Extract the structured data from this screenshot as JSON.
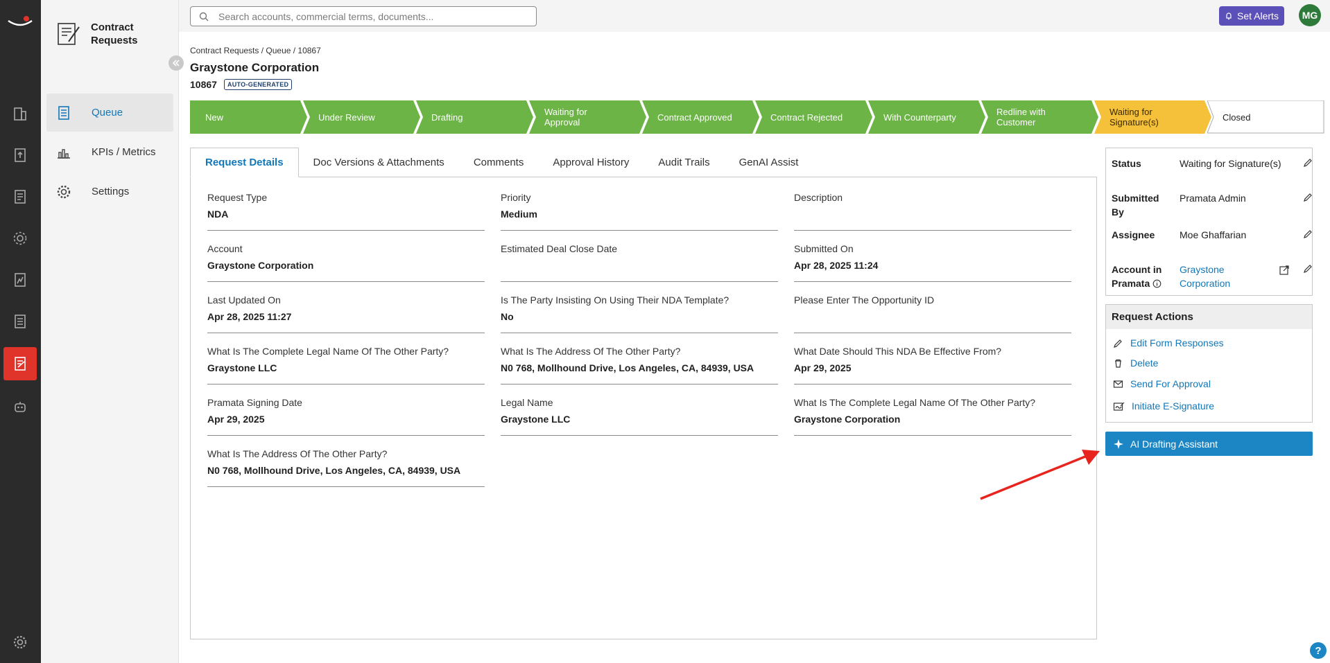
{
  "app": {
    "module_title": "Contract Requests"
  },
  "sidebar": {
    "items": [
      {
        "label": "Queue",
        "icon": "document-list-icon"
      },
      {
        "label": "KPIs / Metrics",
        "icon": "chart-icon"
      },
      {
        "label": "Settings",
        "icon": "gear-icon"
      }
    ]
  },
  "topbar": {
    "search_placeholder": "Search accounts, commercial terms, documents...",
    "alerts_label": "Set Alerts",
    "avatar_initials": "MG"
  },
  "header": {
    "breadcrumb": "Contract Requests / Queue / 10867",
    "title": "Graystone Corporation",
    "request_id": "10867",
    "badge": "AUTO-GENERATED"
  },
  "stages": [
    {
      "label": "New",
      "state": "done"
    },
    {
      "label": "Under Review",
      "state": "done"
    },
    {
      "label": "Drafting",
      "state": "done"
    },
    {
      "label": "Waiting for Approval",
      "state": "done"
    },
    {
      "label": "Contract Approved",
      "state": "done"
    },
    {
      "label": "Contract Rejected",
      "state": "done"
    },
    {
      "label": "With Counterparty",
      "state": "done"
    },
    {
      "label": "Redline with Customer",
      "state": "done"
    },
    {
      "label": "Waiting for Signature(s)",
      "state": "current"
    },
    {
      "label": "Closed",
      "state": "pending"
    }
  ],
  "colors": {
    "done": "#6bb445",
    "current": "#f5c03a",
    "accent": "#1277b8",
    "ai_button": "#1b86c3",
    "alerts": "#5b4fb8"
  },
  "tabs": [
    {
      "label": "Request Details",
      "active": true
    },
    {
      "label": "Doc Versions & Attachments"
    },
    {
      "label": "Comments"
    },
    {
      "label": "Approval History"
    },
    {
      "label": "Audit Trails"
    },
    {
      "label": "GenAI Assist"
    }
  ],
  "fields": [
    {
      "label": "Request Type",
      "value": "NDA"
    },
    {
      "label": "Priority",
      "value": "Medium"
    },
    {
      "label": "Description",
      "value": ""
    },
    {
      "label": "Account",
      "value": "Graystone Corporation"
    },
    {
      "label": "Estimated Deal Close Date",
      "value": ""
    },
    {
      "label": "Submitted On",
      "value": "Apr 28, 2025 11:24"
    },
    {
      "label": "Last Updated On",
      "value": "Apr 28, 2025 11:27"
    },
    {
      "label": "Is The Party Insisting On Using Their NDA Template?",
      "value": "No"
    },
    {
      "label": "Please Enter The Opportunity ID",
      "value": ""
    },
    {
      "label": "What Is The Complete Legal Name Of The Other Party?",
      "value": "Graystone LLC"
    },
    {
      "label": "What Is The Address Of The Other Party?",
      "value": "N0 768, Mollhound Drive, Los Angeles, CA, 84939, USA"
    },
    {
      "label": "What Date Should This NDA Be Effective From?",
      "value": "Apr 29, 2025"
    },
    {
      "label": "Pramata Signing Date",
      "value": "Apr 29, 2025"
    },
    {
      "label": "Legal Name",
      "value": "Graystone LLC"
    },
    {
      "label": "What Is The Complete Legal Name Of The Other Party?",
      "value": "Graystone Corporation"
    },
    {
      "label": "What Is The Address Of The Other Party?",
      "value": "N0 768, Mollhound Drive, Los Angeles, CA, 84939, USA"
    }
  ],
  "info": {
    "status_label": "Status",
    "status_value": "Waiting for Signature(s)",
    "submitted_label": "Submitted By",
    "submitted_value": "Pramata Admin",
    "assignee_label": "Assignee",
    "assignee_value": "Moe Ghaffarian",
    "account_label": "Account in Pramata",
    "account_value": "Graystone Corporation"
  },
  "actions": {
    "title": "Request Actions",
    "items": [
      {
        "label": "Edit Form Responses",
        "icon": "pencil-icon"
      },
      {
        "label": "Delete",
        "icon": "trash-icon"
      },
      {
        "label": "Send For Approval",
        "icon": "envelope-icon"
      },
      {
        "label": "Initiate E-Signature",
        "icon": "signature-icon"
      }
    ]
  },
  "ai_button_label": "AI Drafting Assistant",
  "help_label": "?"
}
